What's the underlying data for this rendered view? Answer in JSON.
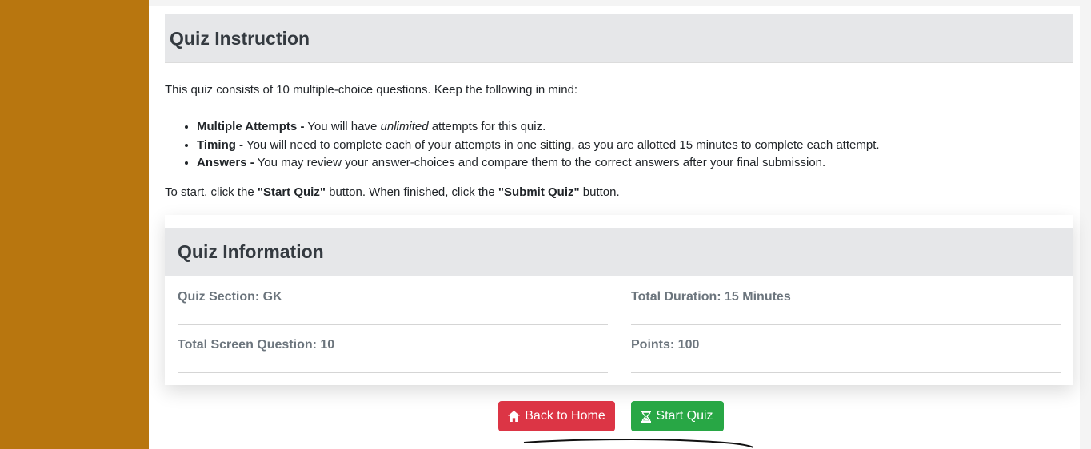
{
  "instruction": {
    "title": "Quiz Instruction",
    "intro": "This quiz consists of 10 multiple-choice questions. Keep the following in mind:",
    "rules": [
      {
        "label": "Multiple Attempts -",
        "before": " You will have ",
        "emphasis": "unlimited",
        "after": " attempts for this quiz."
      },
      {
        "label": "Timing -",
        "text": " You will need to complete each of your attempts in one sitting, as you are allotted 15 minutes to complete each attempt."
      },
      {
        "label": "Answers -",
        "text": " You may review your answer-choices and compare them to the correct answers after your final submission."
      }
    ],
    "start_text": {
      "p1": "To start, click the ",
      "b1": "\"Start Quiz\"",
      "p2": " button. When finished, click the ",
      "b2": "\"Submit Quiz\"",
      "p3": " button."
    }
  },
  "info": {
    "title": "Quiz Information",
    "section": "Quiz Section: GK",
    "duration": "Total Duration: 15 Minutes",
    "questions": "Total Screen Question: 10",
    "points": "Points: 100"
  },
  "buttons": {
    "home_label": "Back to Home",
    "start_label": "Start Quiz"
  },
  "colors": {
    "sidebar": "#b8760f",
    "danger": "#dc3545",
    "success": "#28a745"
  },
  "icons": {
    "home": "home-icon",
    "start": "hourglass-icon"
  }
}
